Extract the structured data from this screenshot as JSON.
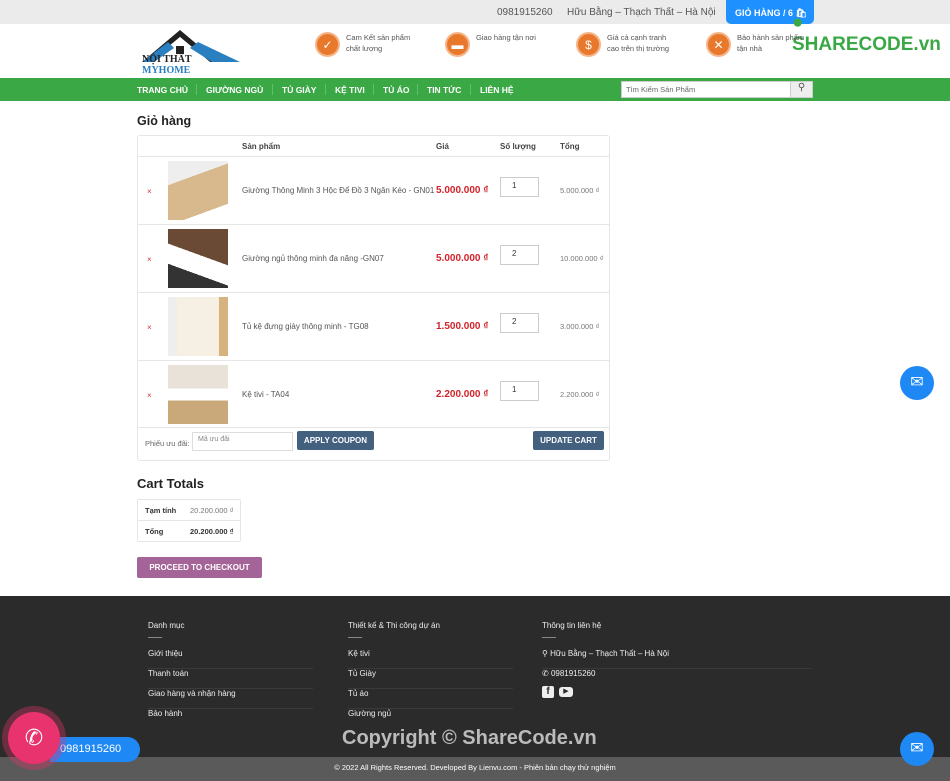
{
  "topbar": {
    "phone": "0981915260",
    "address": "Hữu Bằng – Thạch Thất – Hà Nội",
    "cart_label": "GIỎ HÀNG / 6",
    "watermark_a": "SHARE",
    "watermark_b": "CODE.vn"
  },
  "logo": {
    "text_a": "NỘI THẤT ",
    "text_b": "MYHOME"
  },
  "features": [
    {
      "icon": "check-badge",
      "text": "Cam Kết sản phẩm chất lượng"
    },
    {
      "icon": "truck",
      "text": "Giao hàng tận nơi"
    },
    {
      "icon": "dollar",
      "text": "Giá cả cạnh tranh cao trên thị trường"
    },
    {
      "icon": "tools",
      "text": "Bảo hành sản phẩm tận nhà"
    }
  ],
  "nav": [
    "TRANG CHỦ",
    "GIƯỜNG NGỦ",
    "TỦ GIÀY",
    "KỆ TIVI",
    "TỦ ÁO",
    "TIN TỨC",
    "LIÊN HỆ"
  ],
  "search": {
    "placeholder": "Tìm Kiếm Sản Phẩm"
  },
  "cart": {
    "title": "Giỏ hàng",
    "headers": {
      "product": "Sản phẩm",
      "price": "Giá",
      "qty": "Số lượng",
      "total": "Tổng"
    },
    "items": [
      {
        "name": "Giường Thông Minh 3 Hộc Để Đồ 3 Ngăn Kéo - GN01",
        "price": "5.000.000 ₫",
        "qty": "1",
        "total": "5.000.000 ₫"
      },
      {
        "name": "Giường ngủ thông minh đa năng -GN07",
        "price": "5.000.000 ₫",
        "qty": "2",
        "total": "10.000.000 ₫"
      },
      {
        "name": "Tủ kệ đựng giày thông minh - TG08",
        "price": "1.500.000 ₫",
        "qty": "2",
        "total": "3.000.000 ₫"
      },
      {
        "name": "Kệ tivi - TA04",
        "price": "2.200.000 ₫",
        "qty": "1",
        "total": "2.200.000 ₫"
      }
    ],
    "coupon_label": "Phiếu ưu đãi:",
    "coupon_placeholder": "Mã ưu đãi",
    "apply": "APPLY COUPON",
    "update": "UPDATE CART",
    "remove": "×"
  },
  "totals": {
    "title": "Cart Totals",
    "subtotal_label": "Tạm tính",
    "subtotal": "20.200.000 ₫",
    "total_label": "Tổng",
    "total": "20.200.000 ₫",
    "checkout": "PROCEED TO CHECKOUT"
  },
  "footer": {
    "col1": {
      "title": "Danh mục",
      "links": [
        "Giới thiệu",
        "Thanh toán",
        "Giao hàng và nhận hàng",
        "Bảo hành"
      ]
    },
    "col2": {
      "title": "Thiết kế & Thi công dự án",
      "links": [
        "Kệ tivi",
        "Tủ Giày",
        "Tủ áo",
        "Giường ngủ"
      ]
    },
    "col3": {
      "title": "Thông tin liên hệ",
      "address": "Hữu Bằng – Thạch Thất – Hà Nội",
      "phone": "0981915260"
    },
    "watermark": "Copyright © ShareCode.vn",
    "copyright": "© 2022 All Rights Reserved. Developed By Lienvu.com - Phiên bản chạy thử nghiệm"
  },
  "floating": {
    "call_phone": "0981915260"
  }
}
